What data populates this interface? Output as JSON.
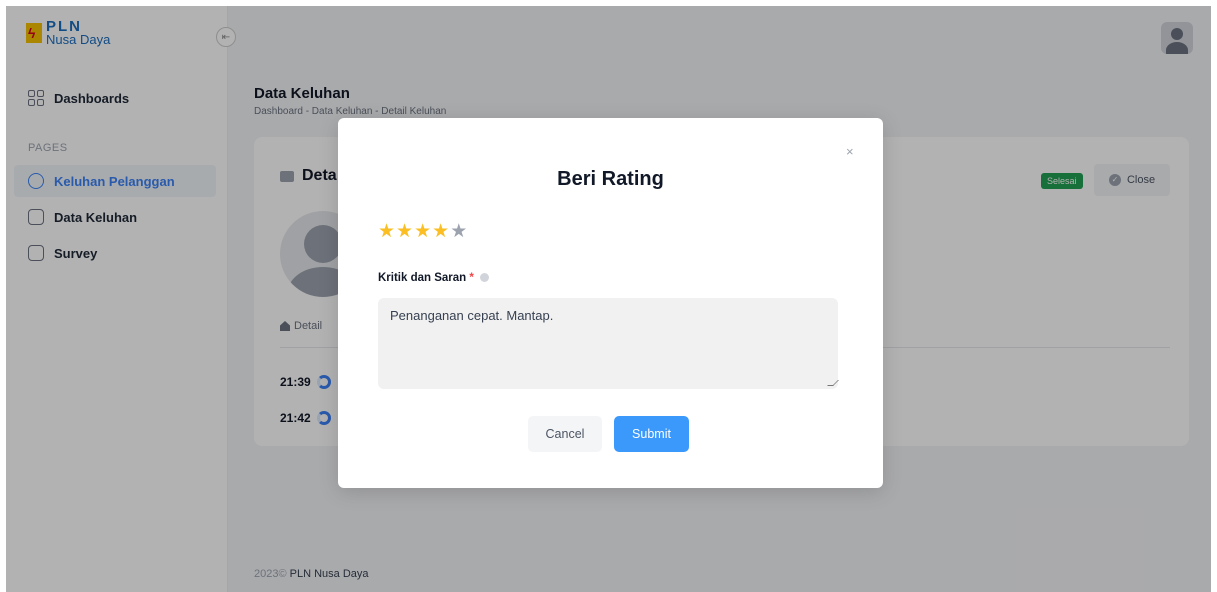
{
  "brand": {
    "name": "PLN",
    "sub": "Nusa Daya"
  },
  "sidebar": {
    "section_label": "PAGES",
    "dashboards_label": "Dashboards",
    "items": [
      {
        "label": "Keluhan Pelanggan",
        "icon": "headset-icon",
        "active": true
      },
      {
        "label": "Data Keluhan",
        "icon": "clipboard-icon",
        "active": false
      },
      {
        "label": "Survey",
        "icon": "list-icon",
        "active": false
      }
    ]
  },
  "header": {
    "title": "Data Keluhan",
    "breadcrumb": "Dashboard - Data Keluhan - Detail Keluhan"
  },
  "card": {
    "title": "Deta",
    "badge": "Selesai",
    "close_label": "Close",
    "tab_label": "Detail",
    "times": [
      "21:39",
      "21:42"
    ]
  },
  "footer": {
    "year": "2023©",
    "text": "PLN Nusa Daya"
  },
  "modal": {
    "close_glyph": "×",
    "title": "Beri Rating",
    "rating": 4,
    "rating_max": 5,
    "field_label": "Kritik dan Saran",
    "required_mark": "*",
    "textarea_value": "Penanganan cepat. Mantap.",
    "cancel_label": "Cancel",
    "submit_label": "Submit"
  },
  "colors": {
    "accent": "#3b99fc",
    "badge": "#22a052",
    "star": "#fbbf24"
  }
}
